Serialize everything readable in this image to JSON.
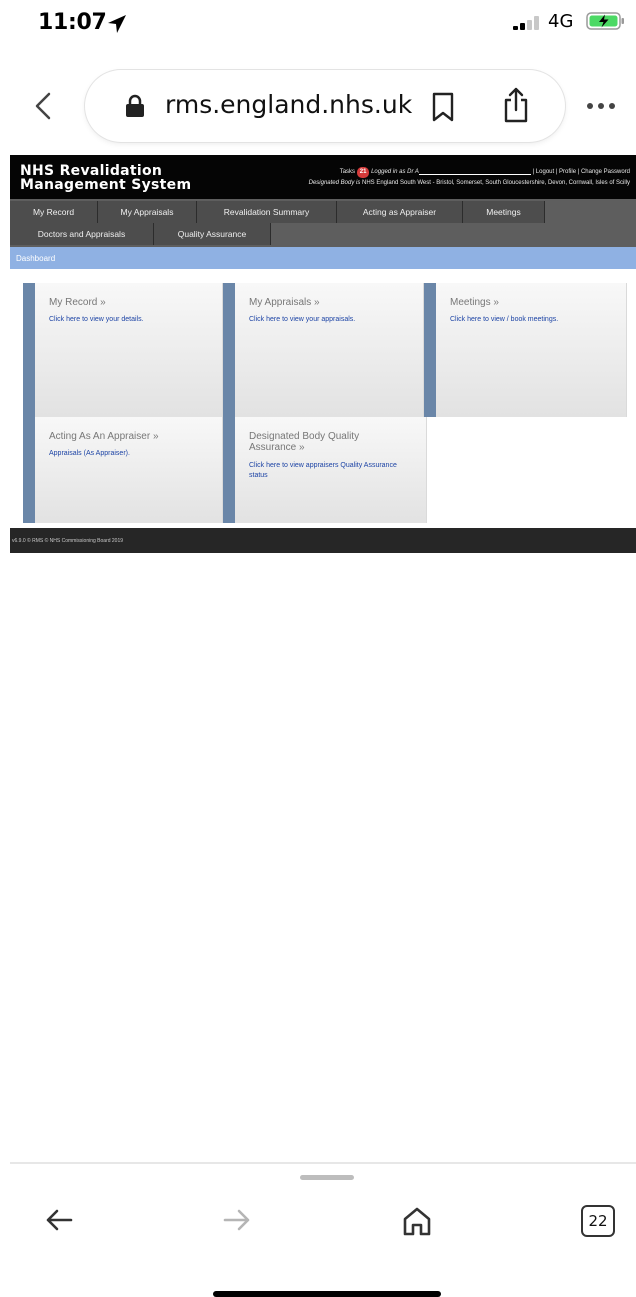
{
  "status_bar": {
    "time": "11:07",
    "network": "4G"
  },
  "browser": {
    "url": "rms.england.nhs.uk",
    "tab_count": "22"
  },
  "rms": {
    "logo_line1": "NHS Revalidation",
    "logo_line2": "Management System",
    "tasks_label": "Tasks",
    "tasks_count": "21",
    "logged_in_label": "Logged in as Dr A",
    "logout": "| Logout",
    "profile": "| Profile",
    "change_password": "| Change Password",
    "designated_body_label": "Designated Body is",
    "designated_body_value": "NHS England South West - Bristol, Somerset, South Gloucestershire, Devon, Cornwall, Isles of Scilly",
    "nav_row1": [
      "My Record",
      "My Appraisals",
      "Revalidation Summary",
      "Acting as Appraiser",
      "Meetings"
    ],
    "nav_row2": [
      "Doctors and Appraisals",
      "Quality Assurance"
    ],
    "breadcrumb": "Dashboard",
    "tiles": [
      {
        "title": "My Record »",
        "link": "Click here to view your details."
      },
      {
        "title": "My Appraisals »",
        "link": "Click here to view your appraisals."
      },
      {
        "title": "Meetings »",
        "link": "Click here to view / book meetings."
      },
      {
        "title": "Acting As An Appraiser »",
        "link": "Appraisals (As Appraiser)."
      },
      {
        "title": "Designated Body Quality Assurance »",
        "link": "Click here to view appraisers Quality Assurance status"
      }
    ],
    "footer": "v6.9.0 © RMS © NHS Commissioning Board 2019"
  },
  "icons": {
    "location": "location-arrow-icon",
    "signal": "cellular-signal-icon",
    "battery": "battery-charging-icon",
    "back": "chevron-left-icon",
    "lock": "lock-icon",
    "bookmark": "bookmark-icon",
    "share": "share-icon",
    "more": "more-dots-icon",
    "nav_back": "arrow-left-icon",
    "nav_forward": "arrow-right-icon",
    "home": "home-icon",
    "tabs": "tabs-icon"
  },
  "colors": {
    "header_bg": "#050505",
    "nav_bg": "#4d4d4d",
    "breadcrumb_bg": "#8fb1e3",
    "tile_accent": "#6a86a8",
    "link": "#1d44a5",
    "tasks_badge": "#d43a3a",
    "battery_charge": "#4cd964"
  }
}
